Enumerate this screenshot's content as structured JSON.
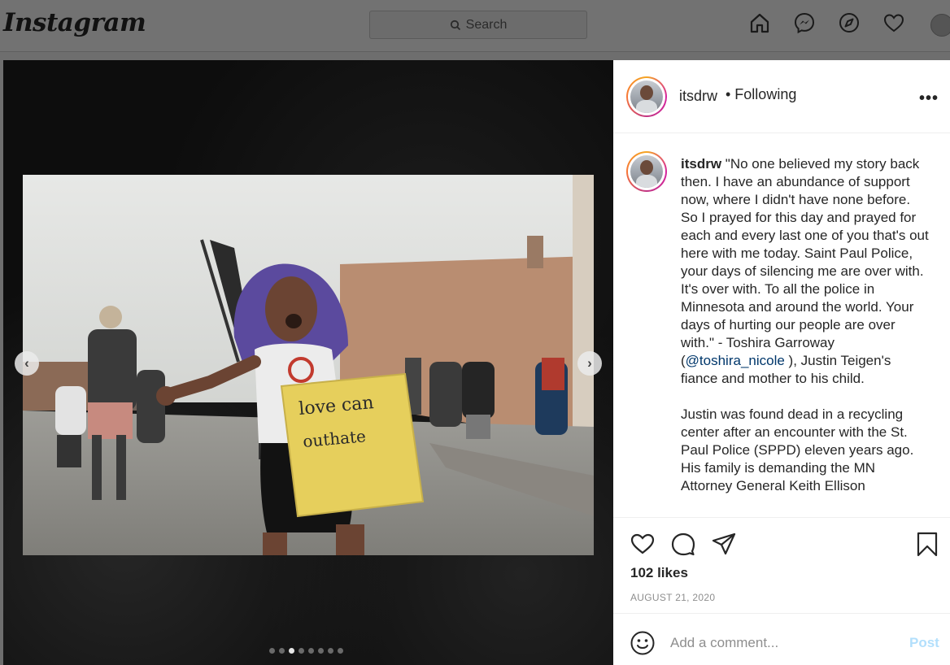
{
  "nav": {
    "logo": "Instagram",
    "search_placeholder": "Search",
    "icons": [
      "home-icon",
      "messenger-icon",
      "explore-icon",
      "heart-icon",
      "profile-avatar"
    ]
  },
  "post": {
    "username": "itsdrw",
    "following_label": "• Following",
    "more_label": "•••",
    "caption": {
      "paragraph1_before": "\"No one believed my story back then. I have an abundance of support now, where I didn't have none before. So I prayed for this day and prayed for each and every last one of you that's out here with me today. Saint Paul Police, your days of silencing me are over with. It's over with. To all the police in Minnesota and around the world. Your days of hurting our people are over with.\" - Toshira Garroway (",
      "mention": "@toshira_nicole",
      "paragraph1_after": " ), Justin Teigen's fiance and mother to his child.",
      "paragraph2": "Justin was found dead in a recycling center after an encounter with the St. Paul Police (SPPD) eleven years ago. His family is demanding the MN Attorney General Keith Ellison"
    },
    "likes": "102 likes",
    "date": "AUGUST 21, 2020",
    "comment_placeholder": "Add a comment...",
    "post_button": "Post",
    "carousel": {
      "total": 8,
      "active_index": 2
    }
  },
  "colors": {
    "link": "#00376b",
    "post_button_disabled": "#b2dffc",
    "date_gray": "#8e8e8e"
  }
}
